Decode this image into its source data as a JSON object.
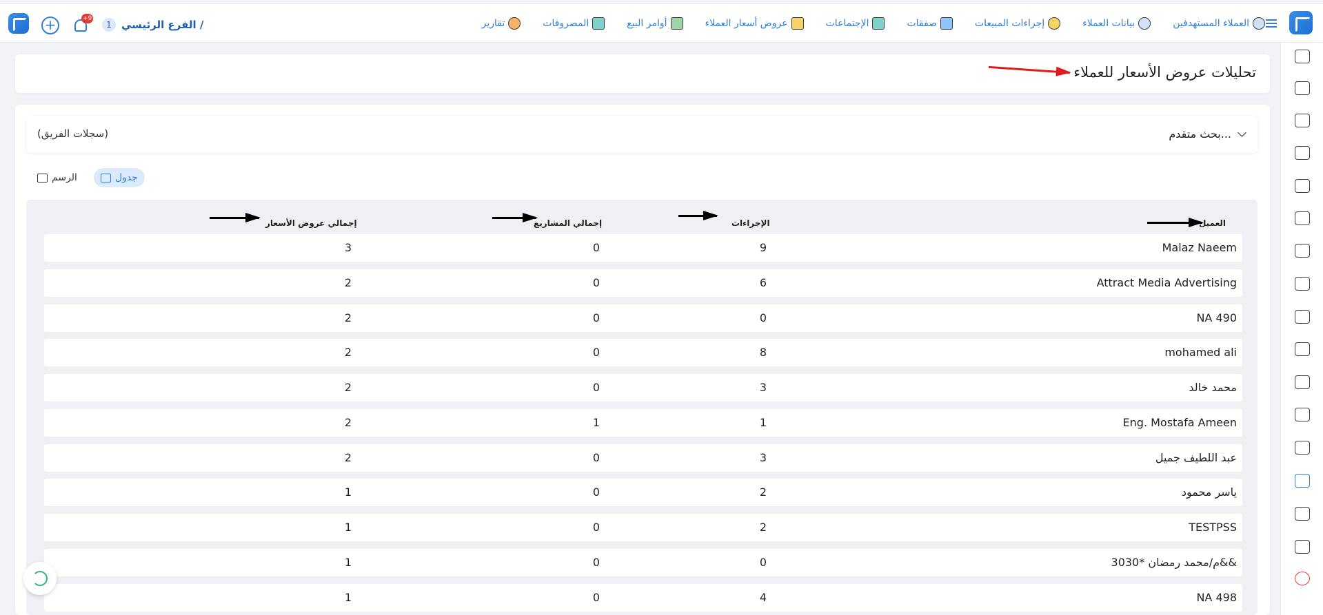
{
  "topbar": {
    "branch_label": "الفرع الرئيسي /",
    "branch_number": "1",
    "notifications_badge": "+9",
    "nav": [
      {
        "label": "العملاء المستهدفين",
        "icon": "targeted-clients-icon"
      },
      {
        "label": "بيانات العملاء",
        "icon": "client-data-icon"
      },
      {
        "label": "إجراءات المبيعات",
        "icon": "sales-actions-icon"
      },
      {
        "label": "صفقات",
        "icon": "deals-icon"
      },
      {
        "label": "الإجتماعات",
        "icon": "meetings-icon"
      },
      {
        "label": "عروض أسعار العملاء",
        "icon": "client-quotes-icon"
      },
      {
        "label": "أوامر البيع",
        "icon": "sales-orders-icon"
      },
      {
        "label": "المصروفات",
        "icon": "expenses-icon"
      },
      {
        "label": "تقارير",
        "icon": "reports-icon"
      }
    ]
  },
  "page": {
    "title": "تحليلات عروض الأسعار للعملاء"
  },
  "search": {
    "advanced_label": "بحث متقدم...",
    "team_records": "(سجلات الفريق)"
  },
  "view_toggle": {
    "table_label": "جدول",
    "chart_label": "الرسم"
  },
  "table": {
    "headers": {
      "client": "العميل",
      "actions": "الإجراءات",
      "projects": "إجمالي المشاريع",
      "quotes": "إجمالي عروض الأسعار"
    },
    "rows": [
      {
        "client": "Malaz Naeem",
        "actions": "9",
        "projects": "0",
        "quotes": "3"
      },
      {
        "client": "Attract Media Advertising",
        "actions": "6",
        "projects": "0",
        "quotes": "2"
      },
      {
        "client": "NA 490",
        "actions": "0",
        "projects": "0",
        "quotes": "2"
      },
      {
        "client": "mohamed ali",
        "actions": "8",
        "projects": "0",
        "quotes": "2"
      },
      {
        "client": "محمد خالد",
        "actions": "3",
        "projects": "0",
        "quotes": "2"
      },
      {
        "client": "Eng. Mostafa Ameen",
        "actions": "1",
        "projects": "1",
        "quotes": "2"
      },
      {
        "client": "عبد اللطيف جميل",
        "actions": "3",
        "projects": "0",
        "quotes": "2"
      },
      {
        "client": "ياسر محمود",
        "actions": "2",
        "projects": "0",
        "quotes": "1"
      },
      {
        "client": "TESTPSS",
        "actions": "2",
        "projects": "0",
        "quotes": "1"
      },
      {
        "client": "م/محمد رمضان *3030&&",
        "actions": "0",
        "projects": "0",
        "quotes": "1"
      },
      {
        "client": "NA 498",
        "actions": "4",
        "projects": "0",
        "quotes": "1"
      }
    ]
  },
  "colors": {
    "accent": "#2f7fd8",
    "annotation_red": "#e01b1b",
    "annotation_black": "#000000"
  }
}
